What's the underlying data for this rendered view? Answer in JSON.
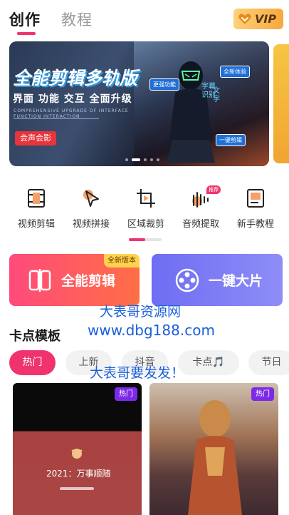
{
  "header": {
    "tabs": [
      {
        "label": "创作",
        "active": true
      },
      {
        "label": "教程",
        "active": false
      }
    ],
    "vip_label": "VIP"
  },
  "banner": {
    "title": "全能剪辑多轨版",
    "subtitle": "界面 功能 交互 全面升级",
    "english_text": "COMPREHENSIVE UPGRADE OF INTERFACE FUNCTION INTERACTION",
    "cta_label": "会声会影",
    "tags": {
      "update": "更强功能",
      "new": "全新体验",
      "oneclick": "一键剪辑"
    },
    "vertical_text_1": "字幕识别",
    "vertical_text_2": "文字",
    "active_slide": 2,
    "slide_count": 5
  },
  "tools": [
    {
      "label": "视频剪辑",
      "icon": "film-strip-icon"
    },
    {
      "label": "视频拼接",
      "icon": "splice-cursor-icon"
    },
    {
      "label": "区域裁剪",
      "icon": "crop-icon"
    },
    {
      "label": "音频提取",
      "icon": "audio-wave-icon",
      "badge": "推荐"
    },
    {
      "label": "新手教程",
      "icon": "book-icon"
    }
  ],
  "cards": {
    "edit": {
      "label": "全能剪辑",
      "badge": "全新版本",
      "icon": "edit-clip-icon"
    },
    "quick": {
      "label": "一键大片",
      "icon": "film-reel-icon"
    }
  },
  "watermark": {
    "line1": "大表哥资源网",
    "line2": "www.dbg188.com",
    "line3": "大表哥要发发！"
  },
  "section": {
    "title": "卡点模板"
  },
  "chips": [
    {
      "label": "热门",
      "active": true
    },
    {
      "label": "上新",
      "active": false
    },
    {
      "label": "抖音",
      "active": false
    },
    {
      "label": "卡点🎵",
      "active": false
    },
    {
      "label": "节日",
      "active": false
    }
  ],
  "templates": [
    {
      "badge": "热门",
      "caption": "2021：万事顺随"
    },
    {
      "badge": "热门"
    }
  ],
  "colors": {
    "accent": "#f0336c",
    "vip_gold": "#f5a93e",
    "card_edit": "#ff4a7b",
    "card_quick": "#6f6df2",
    "watermark_blue": "#1a5fd9"
  }
}
